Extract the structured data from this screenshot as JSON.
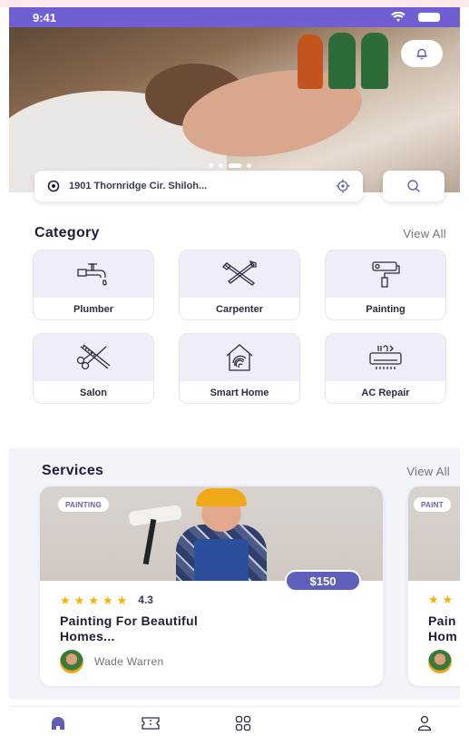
{
  "status_bar": {
    "time": "9:41",
    "icons": [
      "wifi-icon",
      "battery-icon"
    ]
  },
  "hero": {
    "bell_icon": "bell-icon",
    "slider_dots": 3,
    "active_dot": 2
  },
  "location": {
    "address": "1901 Thornridge Cir. Shiloh...",
    "pin_icon": "location-pin-icon",
    "gps_icon": "gps-target-icon"
  },
  "search": {
    "icon": "search-icon"
  },
  "category": {
    "title": "Category",
    "view_all": "View All",
    "items": [
      {
        "label": "Plumber",
        "icon": "faucet-icon"
      },
      {
        "label": "Carpenter",
        "icon": "hammer-tools-icon"
      },
      {
        "label": "Painting",
        "icon": "paint-roller-icon"
      },
      {
        "label": "Salon",
        "icon": "scissors-comb-icon"
      },
      {
        "label": "Smart Home",
        "icon": "smart-home-icon"
      },
      {
        "label": "AC Repair",
        "icon": "air-conditioner-icon"
      }
    ]
  },
  "services": {
    "title": "Services",
    "view_all": "View All",
    "cards": [
      {
        "badge": "PAINTING",
        "price": "$150",
        "rating": "4.3",
        "stars": 5,
        "title_line1": "Painting For Beautiful",
        "title_line2": "Homes...",
        "provider": "Wade Warren"
      },
      {
        "badge": "PAINT",
        "title_line1": "Pain",
        "title_line2": "Hom"
      }
    ]
  },
  "bottom_nav": {
    "items": [
      {
        "icon": "home-icon",
        "active": true
      },
      {
        "icon": "ticket-icon",
        "active": false
      },
      {
        "icon": "grid-icon",
        "active": false
      },
      {
        "icon": "profile-icon",
        "active": false
      }
    ]
  },
  "colors": {
    "primary": "#5f60b9",
    "status_bar": "#6f5fd3",
    "star": "#f5b400",
    "card_tint": "#eeeef8"
  }
}
